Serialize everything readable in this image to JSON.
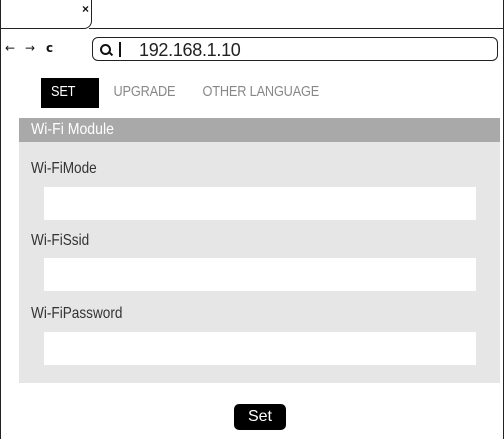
{
  "browser": {
    "tab": {
      "close_glyph": "×",
      "close_icon": "close-icon"
    },
    "nav": {
      "back_glyph": "←",
      "forward_glyph": "→",
      "reload_glyph": "c"
    },
    "address": {
      "url": "192.168.1.10",
      "search_icon": "search-icon"
    }
  },
  "menu": {
    "items": [
      {
        "label": "SET",
        "active": true
      },
      {
        "label": "UPGRADE",
        "active": false
      },
      {
        "label": "OTHER LANGUAGE",
        "active": false
      }
    ]
  },
  "panel": {
    "title": "Wi-Fi Module",
    "fields": [
      {
        "label": "Wi-FiMode",
        "value": ""
      },
      {
        "label": "Wi-FiSsid",
        "value": ""
      },
      {
        "label": "Wi-FiPassword",
        "value": ""
      }
    ]
  },
  "actions": {
    "set_label": "Set"
  },
  "colors": {
    "menu_active_bg": "#000000",
    "panel_header_bg": "#a9a9a9",
    "panel_bg": "#e6e6e6",
    "button_bg": "#000000"
  }
}
